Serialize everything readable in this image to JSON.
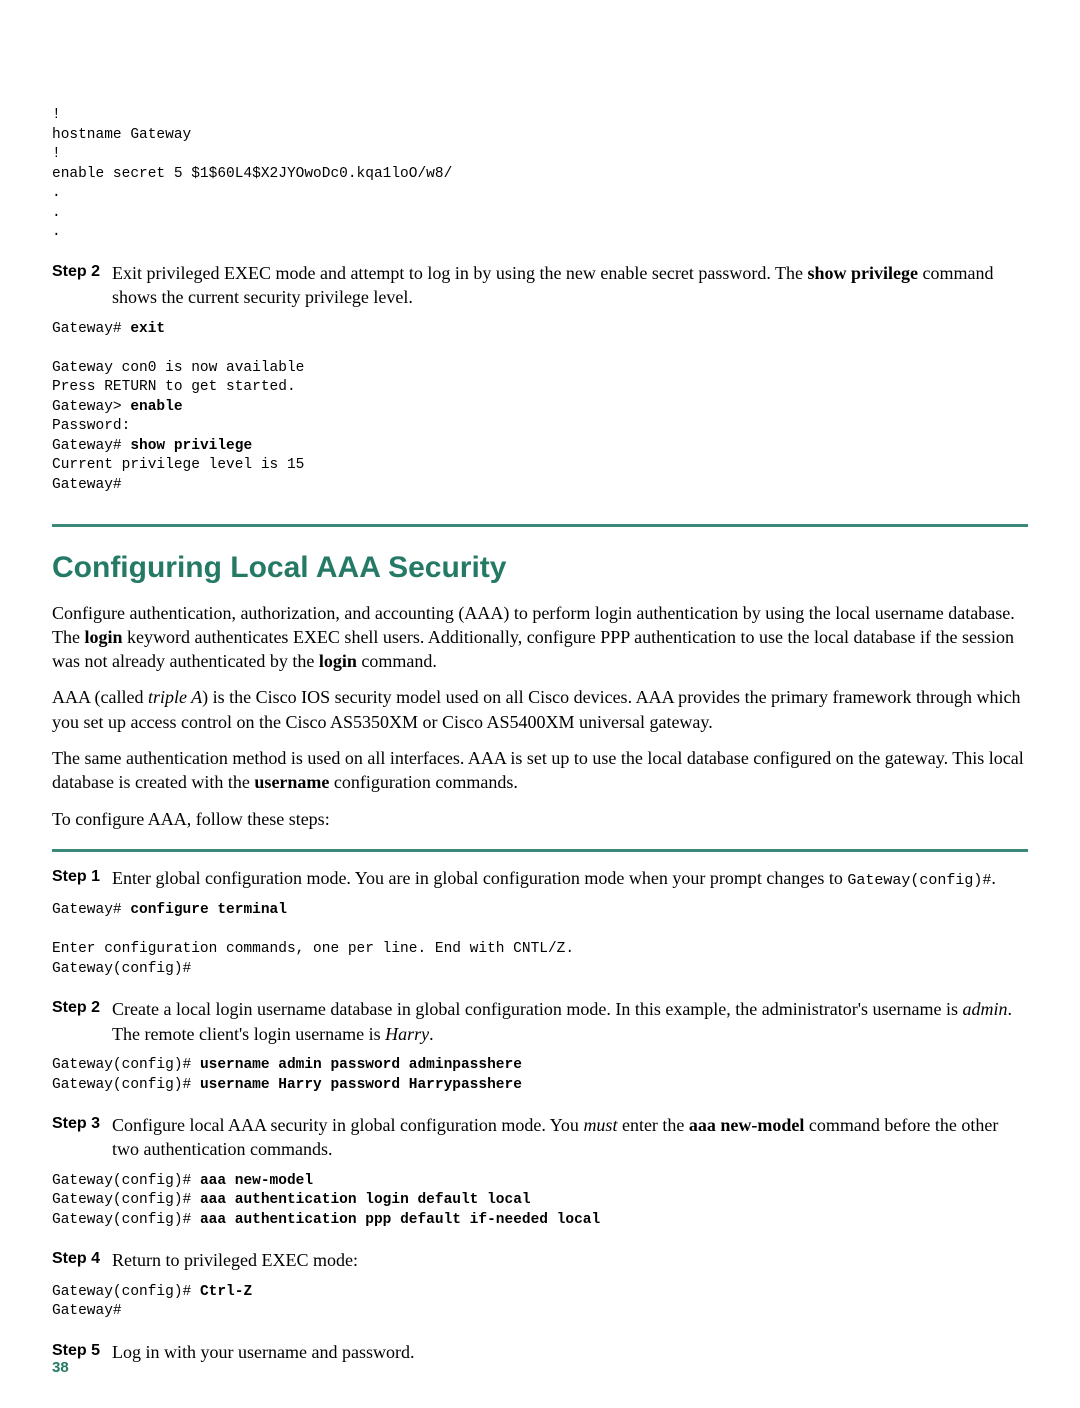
{
  "code_top": "!\nhostname Gateway\n!\nenable secret 5 $1$60L4$X2JYOwoDc0.kqa1loO/w8/\n.\n.\n.",
  "stepA2": {
    "label": "Step 2",
    "text_before": "Exit privileged EXEC mode and attempt to log in by using the new enable secret password. The ",
    "bold1": "show privilege",
    "text_after": " command shows the current security privilege level."
  },
  "codeA2": {
    "l1p": "Gateway# ",
    "l1b": "exit",
    "l2": "",
    "l3": "Gateway con0 is now available",
    "l4": "Press RETURN to get started.",
    "l5p": "Gateway> ",
    "l5b": "enable",
    "l6": "Password:",
    "l7p": "Gateway# ",
    "l7b": "show privilege",
    "l8": "Current privilege level is 15",
    "l9": "Gateway#"
  },
  "section_title": "Configuring Local AAA Security",
  "p1": {
    "t1": "Configure authentication, authorization, and accounting (AAA) to perform login authentication by using the local username database. The ",
    "b1": "login",
    "t2": " keyword authenticates EXEC shell users. Additionally, configure PPP authentication to use the local database if the session was not already authenticated by the ",
    "b2": "login",
    "t3": " command."
  },
  "p2": {
    "t1": "AAA (called ",
    "i1": "triple A",
    "t2": ") is the Cisco IOS security model used on all Cisco devices. AAA provides the primary framework through which you set up access control on the Cisco AS5350XM or Cisco AS5400XM universal gateway."
  },
  "p3": {
    "t1": "The same authentication method is used on all interfaces. AAA is set up to use the local database configured on the gateway. This local database is created with the ",
    "b1": "username",
    "t2": " configuration commands."
  },
  "p4": "To configure AAA, follow these steps:",
  "stepB1": {
    "label": "Step 1",
    "t1": "Enter global configuration mode. You are in global configuration mode when your prompt changes to ",
    "code": "Gateway(config)#",
    "t2": "."
  },
  "codeB1": {
    "l1p": "Gateway# ",
    "l1b": "configure terminal",
    "l2": "",
    "l3": "Enter configuration commands, one per line. End with CNTL/Z.",
    "l4": "Gateway(config)#"
  },
  "stepB2": {
    "label": "Step 2",
    "t1": "Create a local login username database in global configuration mode. In this example, the administrator's username is ",
    "i1": "admin",
    "t2": ". The remote client's login username is ",
    "i2": "Harry",
    "t3": "."
  },
  "codeB2": {
    "l1p": "Gateway(config)# ",
    "l1b": "username admin password adminpasshere",
    "l2p": "Gateway(config)# ",
    "l2b": "username Harry password Harrypasshere"
  },
  "stepB3": {
    "label": "Step 3",
    "t1": "Configure local AAA security in global configuration mode. You ",
    "i1": "must",
    "t2": " enter the ",
    "b1": "aaa new-model",
    "t3": " command before the other two authentication commands."
  },
  "codeB3": {
    "l1p": "Gateway(config)# ",
    "l1b": "aaa new-model",
    "l2p": "Gateway(config)# ",
    "l2b": "aaa authentication login default local",
    "l3p": "Gateway(config)# ",
    "l3b": "aaa authentication ppp default if-needed local"
  },
  "stepB4": {
    "label": "Step 4",
    "text": "Return to privileged EXEC mode:"
  },
  "codeB4": {
    "l1p": "Gateway(config)# ",
    "l1b": "Ctrl-Z",
    "l2": "Gateway#"
  },
  "stepB5": {
    "label": "Step 5",
    "text": "Log in with your username and password."
  },
  "page_number": "38"
}
